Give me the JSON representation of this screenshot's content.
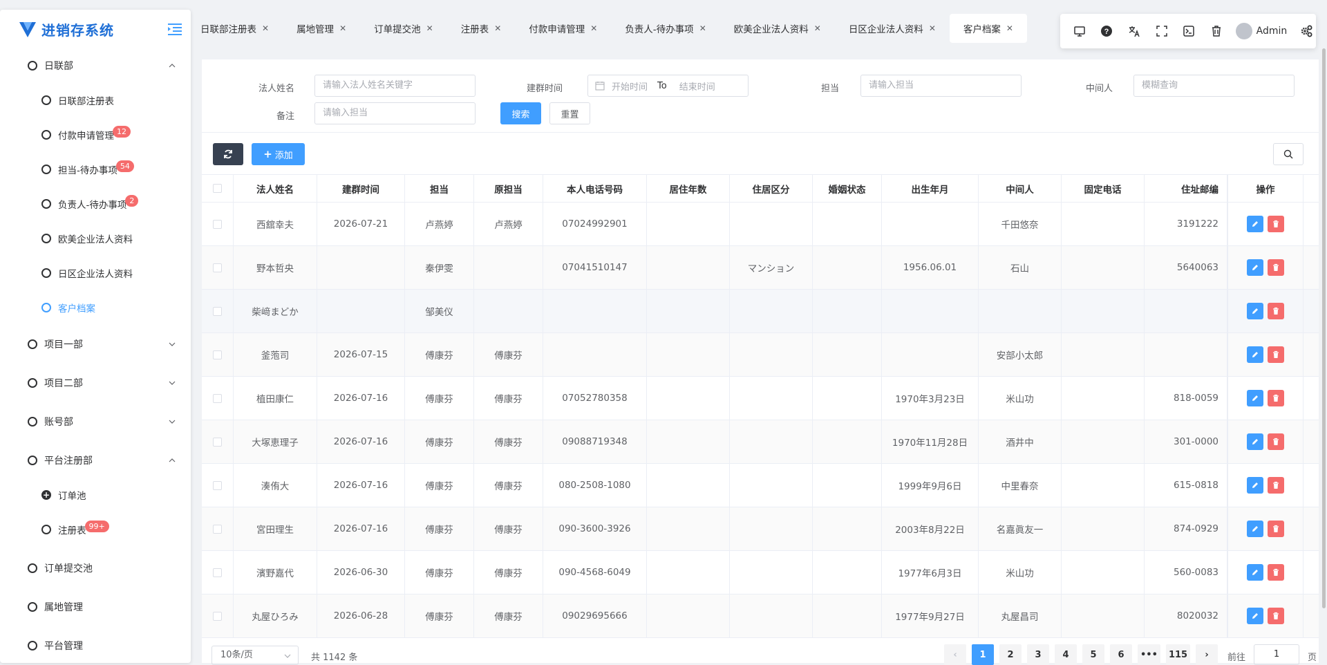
{
  "app": {
    "title": "进销存系统"
  },
  "sidebar": {
    "groups": [
      {
        "label": "日联部",
        "expanded": true,
        "items": [
          {
            "label": "日联部注册表",
            "badge": ""
          },
          {
            "label": "付款申请管理",
            "badge": "12"
          },
          {
            "label": "担当-待办事项",
            "badge": "54"
          },
          {
            "label": "负责人-待办事项",
            "badge": "2"
          },
          {
            "label": "欧美企业法人资料",
            "badge": ""
          },
          {
            "label": "日区企业法人资料",
            "badge": ""
          },
          {
            "label": "客户档案",
            "badge": "",
            "active": true
          }
        ]
      },
      {
        "label": "项目一部",
        "expanded": false
      },
      {
        "label": "项目二部",
        "expanded": false
      },
      {
        "label": "账号部",
        "expanded": false
      },
      {
        "label": "平台注册部",
        "expanded": true,
        "items": [
          {
            "label": "订单池",
            "badge": ""
          },
          {
            "label": "注册表",
            "badge": "99+"
          }
        ]
      },
      {
        "label": "订单提交池"
      },
      {
        "label": "属地管理"
      },
      {
        "label": "平台管理"
      }
    ]
  },
  "tabs": [
    {
      "label": "日联部注册表"
    },
    {
      "label": "属地管理"
    },
    {
      "label": "订单提交池"
    },
    {
      "label": "注册表"
    },
    {
      "label": "付款申请管理"
    },
    {
      "label": "负责人-待办事项"
    },
    {
      "label": "欧美企业法人资料"
    },
    {
      "label": "日区企业法人资料"
    },
    {
      "label": "客户档案",
      "active": true
    }
  ],
  "toolbar": {
    "user": "Admin"
  },
  "search": {
    "name_label": "法人姓名",
    "name_placeholder": "请输入法人姓名关键字",
    "date_label": "建群时间",
    "date_start": "开始时间",
    "date_to": "To",
    "date_end": "结束时间",
    "resp_label": "担当",
    "resp_placeholder": "请输入担当",
    "mid_label": "中间人",
    "mid_placeholder": "模糊查询",
    "note_label": "备注",
    "note_placeholder": "请输入担当",
    "search_btn": "搜索",
    "reset_btn": "重置"
  },
  "actions": {
    "add_label": "添加"
  },
  "table": {
    "headers": [
      "法人姓名",
      "建群时间",
      "担当",
      "原担当",
      "本人电话号码",
      "居住年数",
      "住居区分",
      "婚姻状态",
      "出生年月",
      "中间人",
      "固定电话",
      "住址邮编",
      "操作"
    ],
    "rows": [
      [
        "西舘幸夫",
        "2026-07-21",
        "卢燕婷",
        "卢燕婷",
        "07024992901",
        "",
        "",
        "",
        "",
        "千田悠奈",
        "",
        "3191222"
      ],
      [
        "野本哲央",
        "",
        "秦伊雯",
        "",
        "07041510147",
        "",
        "マンション",
        "",
        "1956.06.01",
        "石山",
        "",
        "5640063"
      ],
      [
        "柴﨑まどか",
        "",
        "邹美仪",
        "",
        "",
        "",
        "",
        "",
        "",
        "",
        "",
        ""
      ],
      [
        "釜萢司",
        "2026-07-15",
        "傅康芬",
        "傅康芬",
        "",
        "",
        "",
        "",
        "",
        "安部小太郎",
        "",
        ""
      ],
      [
        "植田康仁",
        "2026-07-16",
        "傅康芬",
        "傅康芬",
        "07052780358",
        "",
        "",
        "",
        "1970年3月23日",
        "米山功",
        "",
        "818-0059"
      ],
      [
        "大塚恵理子",
        "2026-07-16",
        "傅康芬",
        "傅康芬",
        "09088719348",
        "",
        "",
        "",
        "1970年11月28日",
        "酒井中",
        "",
        "301-0000"
      ],
      [
        "湊侑大",
        "2026-07-16",
        "傅康芬",
        "傅康芬",
        "080-2508-1080",
        "",
        "",
        "",
        "1999年9月6日",
        "中里春奈",
        "",
        "615-0818"
      ],
      [
        "宮田理生",
        "2026-07-16",
        "傅康芬",
        "傅康芬",
        "090-3600-3926",
        "",
        "",
        "",
        "2003年8月22日",
        "名嘉眞友一",
        "",
        "874-0929"
      ],
      [
        "濱野嘉代",
        "2026-06-30",
        "傅康芬",
        "傅康芬",
        "090-4568-6049",
        "",
        "",
        "",
        "1977年6月3日",
        "米山功",
        "",
        "560-0083"
      ],
      [
        "丸屋ひろみ",
        "2026-06-28",
        "傅康芬",
        "傅康芬",
        "09029695666",
        "",
        "",
        "",
        "1977年9月27日",
        "丸屋昌司",
        "",
        "8020032"
      ]
    ]
  },
  "pagination": {
    "page_size": "10条/页",
    "total": "共 1142 条",
    "pages": [
      "1",
      "2",
      "3",
      "4",
      "5",
      "6",
      "•••",
      "115"
    ],
    "current": "1",
    "goto_prefix": "前往",
    "goto_value": "1",
    "goto_suffix": "页"
  },
  "colors": {
    "primary": "#409eff",
    "danger": "#f56c6c",
    "dark": "#374151",
    "brand": "#1f6fd6"
  }
}
